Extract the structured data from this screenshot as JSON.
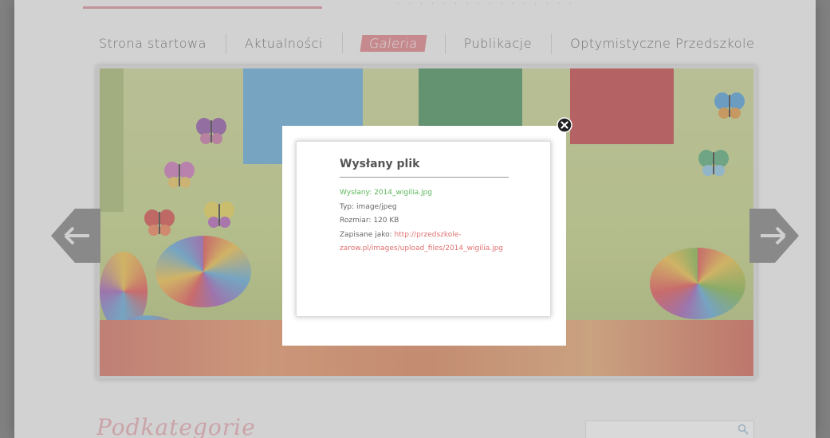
{
  "header": {
    "faded_text": "· · · · · · · · · · · · · · · ·"
  },
  "nav": {
    "items": [
      {
        "label": "Strona startowa"
      },
      {
        "label": "Aktualności"
      },
      {
        "label": "Galeria",
        "active": true
      },
      {
        "label": "Publikacje"
      },
      {
        "label": "Optymistyczne Przedszkole"
      }
    ]
  },
  "slider": {
    "prev_icon": "arrow-left-icon",
    "next_icon": "arrow-right-icon"
  },
  "modal": {
    "title": "Wysłany plik",
    "sent_label": "Wysłany:",
    "sent_value": "2014_wigilia.jpg",
    "type_label": "Typ:",
    "type_value": "image/jpeg",
    "size_label": "Rozmiar:",
    "size_value": "120 KB",
    "saved_label": "Zapisane jako:",
    "saved_value_line1": "http://przedszkole-",
    "saved_value_line2": "zarow.pl/images/upload_files/2014_wigilia.jpg",
    "close_icon": "close-icon"
  },
  "content": {
    "section_title": "Podkategorie",
    "search_placeholder": "",
    "search_icon": "search-icon"
  },
  "colors": {
    "accent": "#e07b83",
    "link": "#e07070",
    "success": "#5cb85c"
  }
}
